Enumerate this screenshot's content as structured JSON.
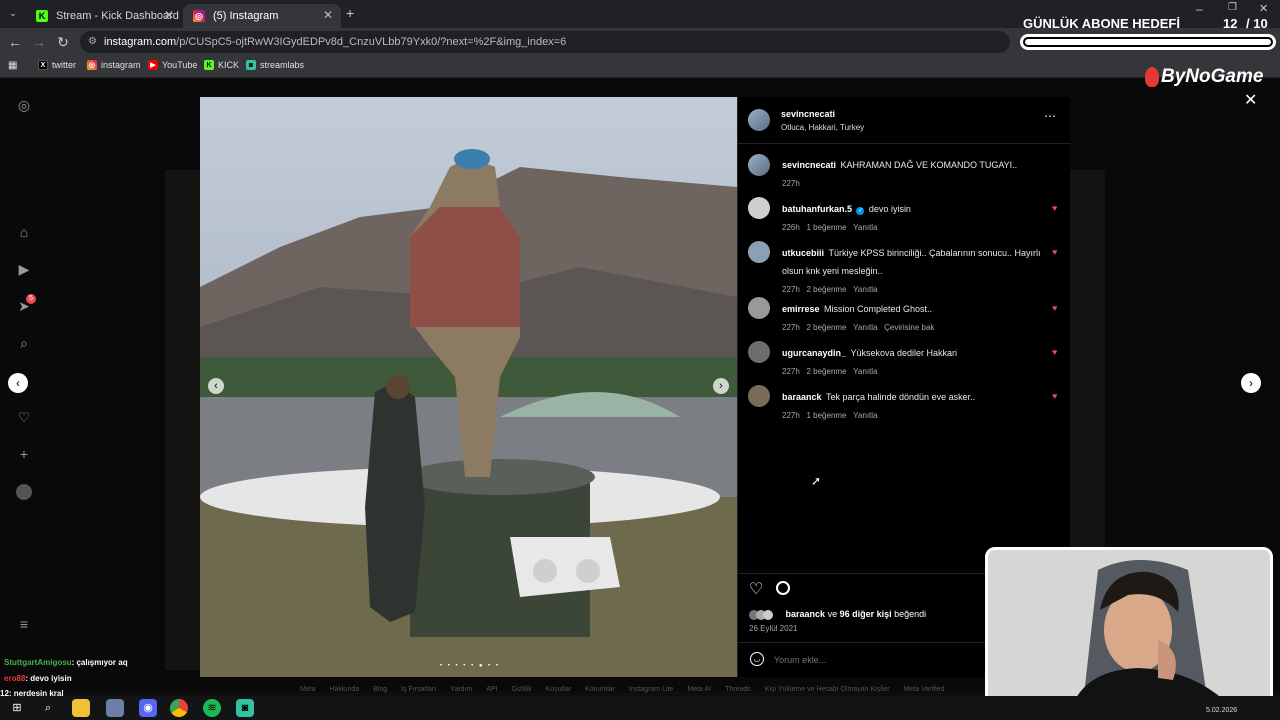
{
  "tabs": [
    {
      "label": "Stream - Kick Dashboard",
      "icon": "kick-icon",
      "active": false
    },
    {
      "label": "(5) Instagram",
      "icon": "instagram-icon",
      "active": true
    }
  ],
  "url": {
    "site": "instagram.com",
    "path": "/p/CUSpC5-ojtRwW3IGydEDPv8d_CnzuVLbb79Yxk0/?next=%2F&img_index=6"
  },
  "bookmarks": [
    "twitter",
    "instagram",
    "YouTube",
    "KICK",
    "streamlabs"
  ],
  "post": {
    "author": "sevincnecati",
    "location": "Otluca, Hakkari, Turkey",
    "caption_user": "sevincnecati",
    "caption_text": "KAHRAMAN DAĞ VE KOMANDO TUGAYI..",
    "caption_time": "227h",
    "comments": [
      {
        "user": "batuhanfurkan.5",
        "text": "devo iyisin",
        "time": "226h",
        "likes": "1 beğenme",
        "reply": "Yanıtla",
        "extra": ""
      },
      {
        "user": "utkucebiii",
        "text": "Türkiye KPSS birinciliği.. Çabalarının sonucu.. Hayırlı olsun knk yeni mesleğin..",
        "time": "227h",
        "likes": "2 beğenme",
        "reply": "Yanıtla",
        "extra": ""
      },
      {
        "user": "emirrese",
        "text": "Mission Completed Ghost..",
        "time": "227h",
        "likes": "2 beğenme",
        "reply": "Yanıtla",
        "extra": "Çevirisine bak"
      },
      {
        "user": "ugurcanaydin_",
        "text": "Yüksekova dediler Hakkari",
        "time": "227h",
        "likes": "2 beğenme",
        "reply": "Yanıtla",
        "extra": ""
      },
      {
        "user": "baraanck",
        "text": "Tek parça halinde döndün eve asker..",
        "time": "227h",
        "likes": "1 beğenme",
        "reply": "Yanıtla",
        "extra": ""
      }
    ],
    "likes_user": "baraanck",
    "likes_middle": "ve",
    "likes_others": "96 diğer kişi",
    "likes_suffix": "beğendi",
    "date": "26 Eylül 2021",
    "comment_placeholder": "Yorum ekle..."
  },
  "overlay": {
    "goal_title": "GÜNLÜK ABONE HEDEFİ",
    "goal_current": "12",
    "goal_target": "/ 10",
    "brand": "ByNoGame"
  },
  "chat": [
    {
      "user": "StuttgartAmigosu",
      "text": ": çalışmıyor aq",
      "color": "#4caf50"
    },
    {
      "user": "ero88",
      "text": ": devo iyisin",
      "color": "#e53935"
    },
    {
      "user": "12",
      "text": ": nerdesin kral",
      "color": "#ffffff"
    }
  ],
  "footer_links": [
    "Meta",
    "Hakkında",
    "Blog",
    "İş Fırsatları",
    "Yardım",
    "API",
    "Gizlilik",
    "Koşullar",
    "Konumlar",
    "Instagram Lite",
    "Meta AI",
    "Threads",
    "Kişi Yükleme ve Hesabı Olmayan Kişiler",
    "Meta Verified"
  ],
  "taskbar_date": "5.02.2026",
  "nav_badge": "5",
  "colors": {
    "accent_heart": "#ed4956",
    "verified": "#0095f6",
    "kick_green": "#53fc18"
  }
}
